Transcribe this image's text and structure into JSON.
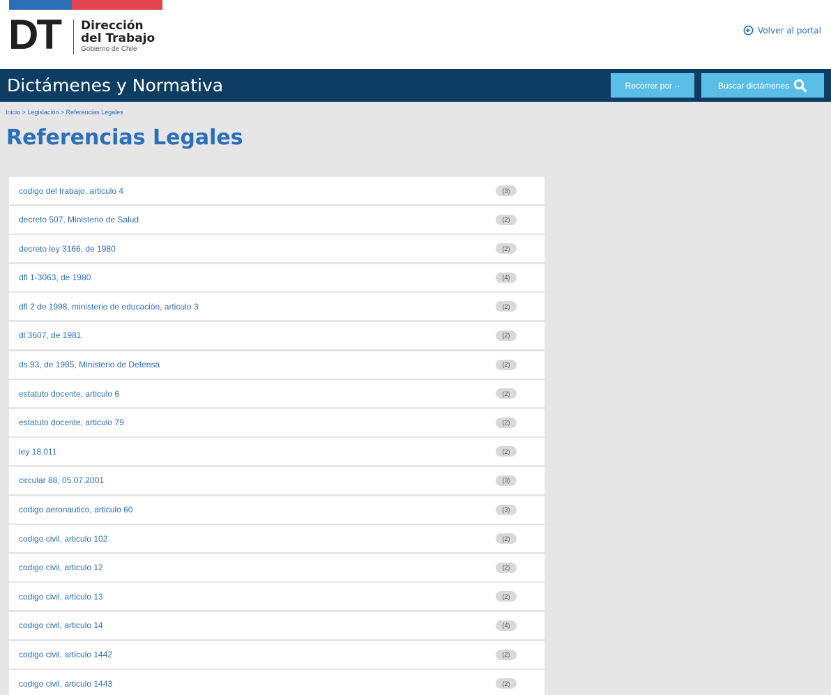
{
  "header": {
    "logo_mark": "DT",
    "logo_line1": "Dirección",
    "logo_line2": "del Trabajo",
    "logo_line3": "Gobierno de Chile",
    "back_link": "Volver al portal",
    "colors": {
      "flag_blue": "#2d6fb7",
      "flag_red": "#e4434b"
    }
  },
  "navbar": {
    "title": "Dictámenes y Normativa",
    "btn_recorrer": "Recorrer por ··",
    "btn_buscar": "Buscar dictámenes",
    "colors": {
      "bar": "#0e3d63",
      "button": "#5bbee6"
    }
  },
  "breadcrumb": {
    "items": [
      "Inicio",
      "Legislación",
      "Referencias Legales"
    ],
    "separator": ">"
  },
  "page_title": "Referencias Legales",
  "references": [
    {
      "label": "codigo del trabajo, articulo 4",
      "count": "(3)"
    },
    {
      "label": "decreto 507, Ministerio de Salud",
      "count": "(2)"
    },
    {
      "label": "decreto ley 3166, de 1980",
      "count": "(2)"
    },
    {
      "label": "dfl 1-3063, de 1980",
      "count": "(4)"
    },
    {
      "label": "dfl 2 de 1998, ministerio de educación, articulo 3",
      "count": "(2)"
    },
    {
      "label": "dl 3607, de 1981",
      "count": "(2)"
    },
    {
      "label": "ds 93, de 1985, Ministerio de Defensa",
      "count": "(2)"
    },
    {
      "label": "estatuto docente, articulo 6",
      "count": "(2)"
    },
    {
      "label": "estatuto docente, articulo 79",
      "count": "(2)"
    },
    {
      "label": "ley 18.011",
      "count": "(2)"
    },
    {
      "label": "circular 88, 05.07.2001",
      "count": "(3)"
    },
    {
      "label": "codigo aeronautico, articulo 60",
      "count": "(3)"
    },
    {
      "label": "codigo civil, articulo 102",
      "count": "(2)"
    },
    {
      "label": "codigo civil, articulo 12",
      "count": "(2)"
    },
    {
      "label": "codigo civil, articulo 13",
      "count": "(2)"
    },
    {
      "label": "codigo civil, articulo 14",
      "count": "(4)"
    },
    {
      "label": "codigo civil, articulo 1442",
      "count": "(2)"
    },
    {
      "label": "codigo civil, articulo 1443",
      "count": "(2)"
    }
  ]
}
